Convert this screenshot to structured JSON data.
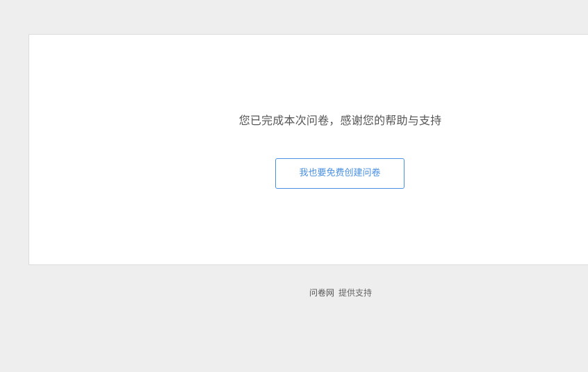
{
  "completion": {
    "message": "您已完成本次问卷，感谢您的帮助与支持",
    "create_button_label": "我也要免费创建问卷"
  },
  "footer": {
    "brand": "问卷网",
    "support_text": "提供支持"
  },
  "colors": {
    "page_background": "#eeeeee",
    "card_background": "#ffffff",
    "accent": "#4a90e2",
    "message_text": "#555555"
  }
}
